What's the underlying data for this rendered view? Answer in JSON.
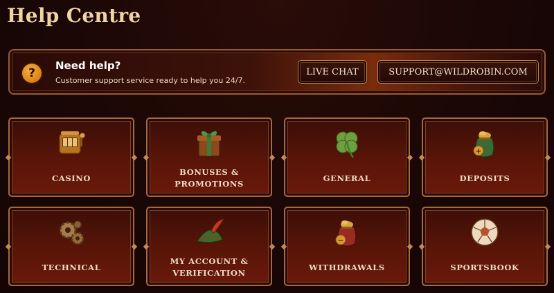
{
  "page": {
    "title": "Help Centre"
  },
  "banner": {
    "icon": "question-icon",
    "icon_glyph": "?",
    "title": "Need help?",
    "subtitle": "Customer support service ready to help you 24/7.",
    "live_chat_label": "LIVE CHAT",
    "email_label": "SUPPORT@WILDROBIN.COM"
  },
  "categories": [
    {
      "label": "CASINO",
      "icon": "slot-machine-icon"
    },
    {
      "label": "BONUSES & PROMOTIONS",
      "icon": "gift-box-icon"
    },
    {
      "label": "GENERAL",
      "icon": "clover-icon"
    },
    {
      "label": "DEPOSITS",
      "icon": "coin-bag-plus-icon"
    },
    {
      "label": "TECHNICAL",
      "icon": "gears-icon"
    },
    {
      "label": "MY ACCOUNT & VERIFICATION",
      "icon": "feathered-hat-icon"
    },
    {
      "label": "WITHDRAWALS",
      "icon": "coin-bag-minus-icon"
    },
    {
      "label": "SPORTSBOOK",
      "icon": "soccer-ball-icon"
    }
  ],
  "colors": {
    "title": "#f2d4a2",
    "accent_orange": "#e08a14",
    "card_border": "#a8683e",
    "card_bg": "#5a1508"
  }
}
